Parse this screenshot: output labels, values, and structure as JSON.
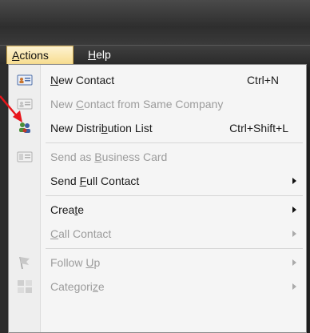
{
  "menubar": {
    "items": [
      {
        "label": "Actions",
        "underline": "A"
      },
      {
        "label": "Help",
        "underline": "H"
      }
    ]
  },
  "menu": {
    "items": [
      {
        "label": "New Contact",
        "shortcut": "Ctrl+N",
        "disabled": false,
        "icon": "contact-card-icon"
      },
      {
        "label": "New Contact from Same Company",
        "shortcut": "",
        "disabled": true,
        "icon": "contact-card-icon"
      },
      {
        "label": "New Distribution List",
        "shortcut": "Ctrl+Shift+L",
        "disabled": false,
        "icon": "distribution-list-icon"
      },
      {
        "label": "Send as Business Card",
        "shortcut": "",
        "disabled": true,
        "icon": "business-card-icon"
      },
      {
        "label": "Send Full Contact",
        "shortcut": "",
        "disabled": false,
        "submenu": true
      },
      {
        "label": "Create",
        "shortcut": "",
        "disabled": false,
        "submenu": true
      },
      {
        "label": "Call Contact",
        "shortcut": "",
        "disabled": true,
        "submenu": true
      },
      {
        "label": "Follow Up",
        "shortcut": "",
        "disabled": true,
        "submenu": true,
        "icon": "flag-icon"
      },
      {
        "label": "Categorize",
        "shortcut": "",
        "disabled": true,
        "submenu": true,
        "icon": "categorize-icon"
      }
    ]
  },
  "colors": {
    "menubar_bg": "#2b2b2b",
    "active_menu_bg": "#f7dc8c",
    "disabled_text": "#9c9c9c",
    "annotation_arrow": "#e8151b"
  }
}
